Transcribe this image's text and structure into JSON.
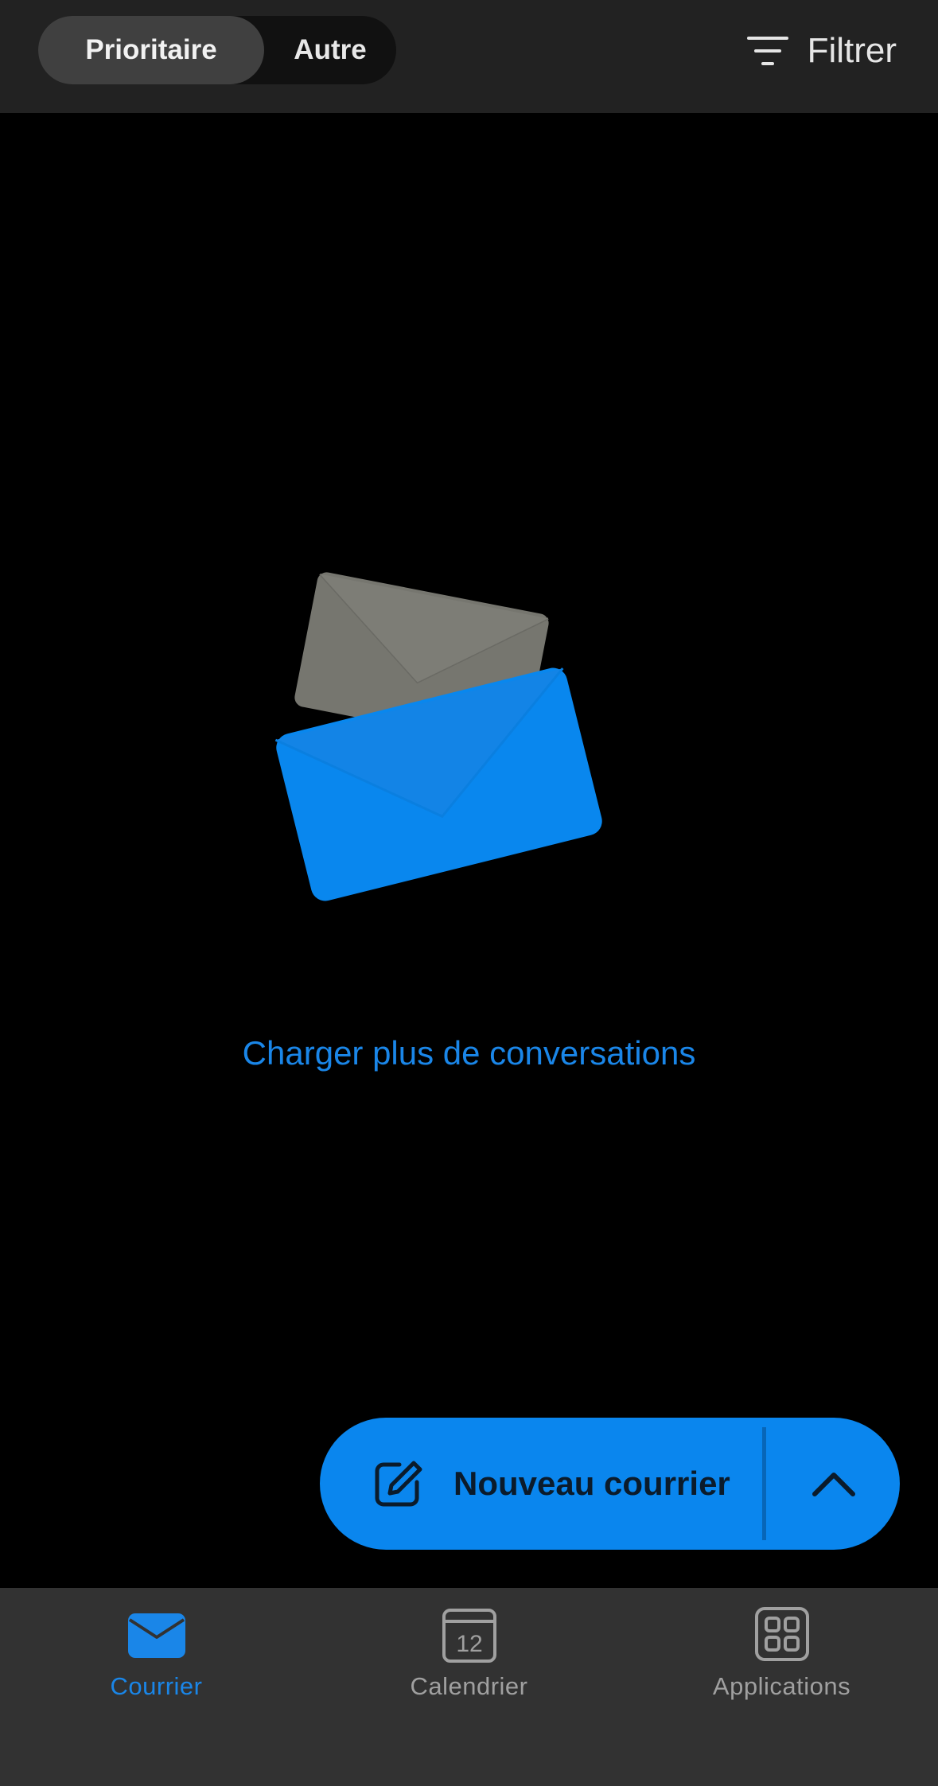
{
  "header": {
    "tabs": [
      {
        "label": "Prioritaire",
        "active": true
      },
      {
        "label": "Autre",
        "active": false
      }
    ],
    "filter_label": "Filtrer",
    "filter_icon": "filter-lines-icon"
  },
  "main": {
    "illustration": "envelopes-illustration",
    "load_more_label": "Charger plus de conversations"
  },
  "fab": {
    "label": "Nouveau courrier",
    "icon": "compose-icon",
    "expand_icon": "chevron-up-icon"
  },
  "bottom_nav": {
    "items": [
      {
        "label": "Courrier",
        "icon": "mail-icon",
        "active": true
      },
      {
        "label": "Calendrier",
        "icon": "calendar-icon",
        "active": false,
        "calendar_day": "12"
      },
      {
        "label": "Applications",
        "icon": "apps-grid-icon",
        "active": false
      }
    ]
  },
  "colors": {
    "accent": "#0a86ee",
    "link": "#1a86e8",
    "background": "#000000",
    "topbar": "#222222",
    "bottom_nav": "#323232"
  }
}
